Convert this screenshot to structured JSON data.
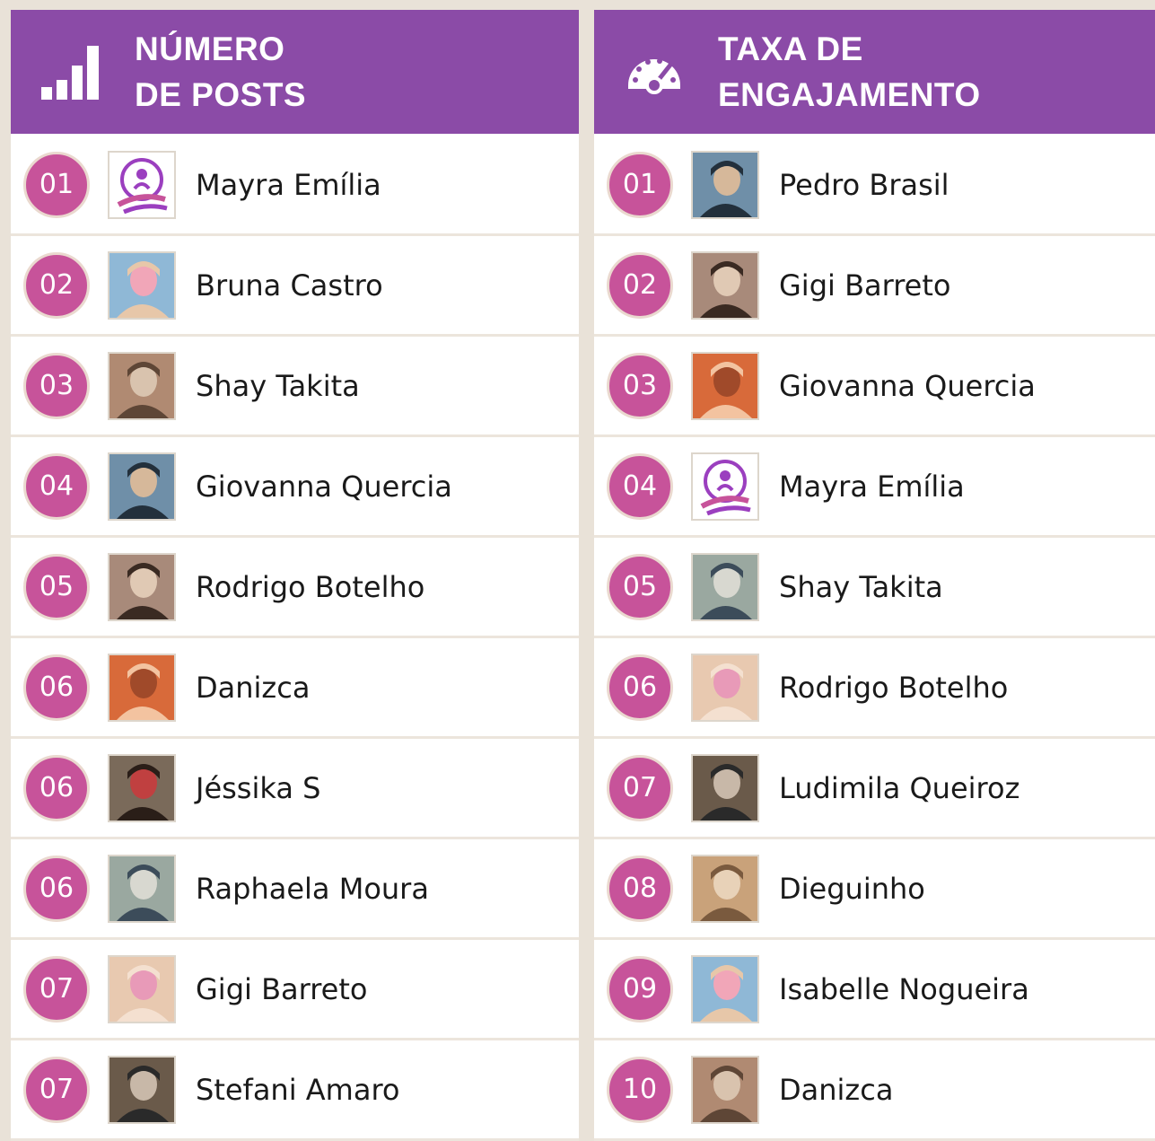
{
  "panels": {
    "left": {
      "icon": "signal-bars-icon",
      "title_line1": "NÚMERO",
      "title_line2": "DE POSTS",
      "rows": [
        {
          "rank": "01",
          "name": "Mayra Emília",
          "avatar": "logo-achadinhos"
        },
        {
          "rank": "02",
          "name": "Bruna Castro",
          "avatar": "photo"
        },
        {
          "rank": "03",
          "name": "Shay Takita",
          "avatar": "photo"
        },
        {
          "rank": "04",
          "name": "Giovanna Quercia",
          "avatar": "photo"
        },
        {
          "rank": "05",
          "name": "Rodrigo Botelho",
          "avatar": "photo"
        },
        {
          "rank": "06",
          "name": "Danizca",
          "avatar": "photo"
        },
        {
          "rank": "06",
          "name": "Jéssika S",
          "avatar": "photo"
        },
        {
          "rank": "06",
          "name": "Raphaela Moura",
          "avatar": "photo"
        },
        {
          "rank": "07",
          "name": "Gigi Barreto",
          "avatar": "photo"
        },
        {
          "rank": "07",
          "name": "Stefani Amaro",
          "avatar": "photo"
        }
      ]
    },
    "right": {
      "icon": "speedometer-icon",
      "title_line1": "TAXA DE",
      "title_line2": "ENGAJAMENTO",
      "rows": [
        {
          "rank": "01",
          "name": "Pedro Brasil",
          "avatar": "photo"
        },
        {
          "rank": "02",
          "name": "Gigi Barreto",
          "avatar": "photo"
        },
        {
          "rank": "03",
          "name": "Giovanna Quercia",
          "avatar": "photo"
        },
        {
          "rank": "04",
          "name": "Mayra Emília",
          "avatar": "logo-achadinhos"
        },
        {
          "rank": "05",
          "name": "Shay Takita",
          "avatar": "photo"
        },
        {
          "rank": "06",
          "name": "Rodrigo Botelho",
          "avatar": "photo"
        },
        {
          "rank": "07",
          "name": "Ludimila Queiroz",
          "avatar": "photo"
        },
        {
          "rank": "08",
          "name": "Dieguinho",
          "avatar": "photo"
        },
        {
          "rank": "09",
          "name": "Isabelle Nogueira",
          "avatar": "photo"
        },
        {
          "rank": "10",
          "name": "Danizca",
          "avatar": "photo"
        }
      ]
    }
  },
  "colors": {
    "header": "#8b4ba7",
    "badge": "#c7539a",
    "frame": "#e9e2d8"
  }
}
